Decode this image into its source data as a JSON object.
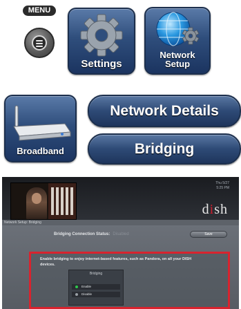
{
  "remote": {
    "menu_label": "MENU",
    "settings_label": "Settings",
    "network_setup_label_line1": "Network",
    "network_setup_label_line2": "Setup",
    "broadband_label": "Broadband",
    "network_details_label": "Network Details",
    "bridging_label": "Bridging"
  },
  "tv_screen": {
    "clock_line1": "Thu 5/27",
    "clock_line2": "5:25 PM",
    "logo_text_1": "d",
    "logo_text_2": "i",
    "logo_text_3": "sh",
    "breadcrumb": "Network Setup: Bridging",
    "status_label": "Bridging Connection Status:",
    "status_value": "Disabled",
    "save_label": "Save",
    "description": "Enable bridging to enjoy internet-based features, such as Pandora, on all your DISH devices.",
    "panel_title": "Bridging",
    "options": [
      {
        "label": "Enable",
        "selected": true
      },
      {
        "label": "Disable",
        "selected": false
      }
    ]
  },
  "colors": {
    "tile_blue": "#2f4e7c",
    "highlight_red": "#d8232e",
    "selected_green": "#2ec84c"
  }
}
